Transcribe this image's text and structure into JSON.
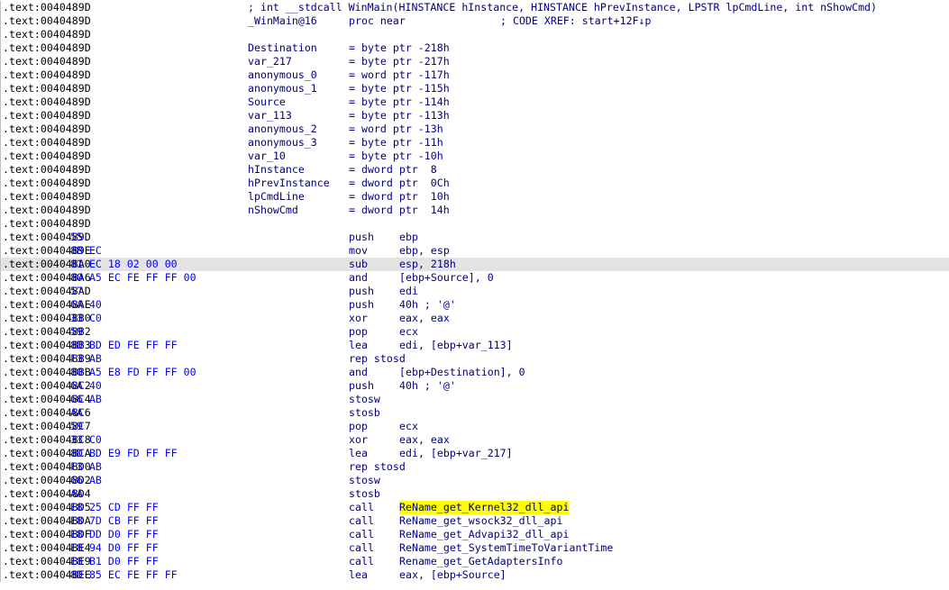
{
  "colors": {
    "address": "#000000",
    "bytes": "#0000ff",
    "code": "#000080",
    "current_line_bg": "#e3e3e3",
    "highlight_bg": "#ffff00"
  },
  "lines": [
    {
      "addr": ".text:0040489D",
      "bytes": "",
      "label": "",
      "mid": "",
      "mnemonic": "",
      "operand": "; int __stdcall WinMain(HINSTANCE hInstance, HINSTANCE hPrevInstance, LPSTR lpCmdLine, int nShowCmd)",
      "comment": ""
    },
    {
      "addr": ".text:0040489D",
      "bytes": "",
      "label": "_WinMain@16",
      "mid": "proc near",
      "mnemonic": "",
      "operand": "",
      "comment": "; CODE XREF: start+12F↓p"
    },
    {
      "addr": ".text:0040489D",
      "bytes": "",
      "label": "",
      "mid": "",
      "mnemonic": "",
      "operand": "",
      "comment": ""
    },
    {
      "addr": ".text:0040489D",
      "bytes": "",
      "label": "Destination",
      "mid": "= byte ptr -218h",
      "mnemonic": "",
      "operand": "",
      "comment": ""
    },
    {
      "addr": ".text:0040489D",
      "bytes": "",
      "label": "var_217",
      "mid": "= byte ptr -217h",
      "mnemonic": "",
      "operand": "",
      "comment": ""
    },
    {
      "addr": ".text:0040489D",
      "bytes": "",
      "label": "anonymous_0",
      "mid": "= word ptr -117h",
      "mnemonic": "",
      "operand": "",
      "comment": ""
    },
    {
      "addr": ".text:0040489D",
      "bytes": "",
      "label": "anonymous_1",
      "mid": "= byte ptr -115h",
      "mnemonic": "",
      "operand": "",
      "comment": ""
    },
    {
      "addr": ".text:0040489D",
      "bytes": "",
      "label": "Source",
      "mid": "= byte ptr -114h",
      "mnemonic": "",
      "operand": "",
      "comment": ""
    },
    {
      "addr": ".text:0040489D",
      "bytes": "",
      "label": "var_113",
      "mid": "= byte ptr -113h",
      "mnemonic": "",
      "operand": "",
      "comment": ""
    },
    {
      "addr": ".text:0040489D",
      "bytes": "",
      "label": "anonymous_2",
      "mid": "= word ptr -13h",
      "mnemonic": "",
      "operand": "",
      "comment": ""
    },
    {
      "addr": ".text:0040489D",
      "bytes": "",
      "label": "anonymous_3",
      "mid": "= byte ptr -11h",
      "mnemonic": "",
      "operand": "",
      "comment": ""
    },
    {
      "addr": ".text:0040489D",
      "bytes": "",
      "label": "var_10",
      "mid": "= byte ptr -10h",
      "mnemonic": "",
      "operand": "",
      "comment": ""
    },
    {
      "addr": ".text:0040489D",
      "bytes": "",
      "label": "hInstance",
      "mid": "= dword ptr  8",
      "mnemonic": "",
      "operand": "",
      "comment": ""
    },
    {
      "addr": ".text:0040489D",
      "bytes": "",
      "label": "hPrevInstance",
      "mid": "= dword ptr  0Ch",
      "mnemonic": "",
      "operand": "",
      "comment": ""
    },
    {
      "addr": ".text:0040489D",
      "bytes": "",
      "label": "lpCmdLine",
      "mid": "= dword ptr  10h",
      "mnemonic": "",
      "operand": "",
      "comment": ""
    },
    {
      "addr": ".text:0040489D",
      "bytes": "",
      "label": "nShowCmd",
      "mid": "= dword ptr  14h",
      "mnemonic": "",
      "operand": "",
      "comment": ""
    },
    {
      "addr": ".text:0040489D",
      "bytes": "",
      "label": "",
      "mid": "",
      "mnemonic": "",
      "operand": "",
      "comment": ""
    },
    {
      "addr": ".text:0040489D",
      "bytes": "55",
      "label": "",
      "mid": "",
      "mnemonic": "push",
      "operand": "ebp",
      "comment": ""
    },
    {
      "addr": ".text:0040489E",
      "bytes": "8B EC",
      "label": "",
      "mid": "",
      "mnemonic": "mov",
      "operand": "ebp, esp",
      "comment": ""
    },
    {
      "addr": ".text:004048A0",
      "bytes": "81 EC 18 02 00 00",
      "label": "",
      "mid": "",
      "mnemonic": "sub",
      "operand": "esp, 218h",
      "comment": "",
      "current": true
    },
    {
      "addr": ".text:004048A6",
      "bytes": "80 A5 EC FE FF FF 00",
      "label": "",
      "mid": "",
      "mnemonic": "and",
      "operand": "[ebp+Source], 0",
      "comment": ""
    },
    {
      "addr": ".text:004048AD",
      "bytes": "57",
      "label": "",
      "mid": "",
      "mnemonic": "push",
      "operand": "edi",
      "comment": ""
    },
    {
      "addr": ".text:004048AE",
      "bytes": "6A 40",
      "label": "",
      "mid": "",
      "mnemonic": "push",
      "operand": "40h ; '@'",
      "comment": ""
    },
    {
      "addr": ".text:004048B0",
      "bytes": "33 C0",
      "label": "",
      "mid": "",
      "mnemonic": "xor",
      "operand": "eax, eax",
      "comment": ""
    },
    {
      "addr": ".text:004048B2",
      "bytes": "59",
      "label": "",
      "mid": "",
      "mnemonic": "pop",
      "operand": "ecx",
      "comment": ""
    },
    {
      "addr": ".text:004048B3",
      "bytes": "8D BD ED FE FF FF",
      "label": "",
      "mid": "",
      "mnemonic": "lea",
      "operand": "edi, [ebp+var_113]",
      "comment": ""
    },
    {
      "addr": ".text:004048B9",
      "bytes": "F3 AB",
      "label": "",
      "mid": "",
      "mnemonic": "rep stosd",
      "operand": "",
      "comment": ""
    },
    {
      "addr": ".text:004048BB",
      "bytes": "80 A5 E8 FD FF FF 00",
      "label": "",
      "mid": "",
      "mnemonic": "and",
      "operand": "[ebp+Destination], 0",
      "comment": ""
    },
    {
      "addr": ".text:004048C2",
      "bytes": "6A 40",
      "label": "",
      "mid": "",
      "mnemonic": "push",
      "operand": "40h ; '@'",
      "comment": ""
    },
    {
      "addr": ".text:004048C4",
      "bytes": "66 AB",
      "label": "",
      "mid": "",
      "mnemonic": "stosw",
      "operand": "",
      "comment": ""
    },
    {
      "addr": ".text:004048C6",
      "bytes": "AA",
      "label": "",
      "mid": "",
      "mnemonic": "stosb",
      "operand": "",
      "comment": ""
    },
    {
      "addr": ".text:004048C7",
      "bytes": "59",
      "label": "",
      "mid": "",
      "mnemonic": "pop",
      "operand": "ecx",
      "comment": ""
    },
    {
      "addr": ".text:004048C8",
      "bytes": "33 C0",
      "label": "",
      "mid": "",
      "mnemonic": "xor",
      "operand": "eax, eax",
      "comment": ""
    },
    {
      "addr": ".text:004048CA",
      "bytes": "8D BD E9 FD FF FF",
      "label": "",
      "mid": "",
      "mnemonic": "lea",
      "operand": "edi, [ebp+var_217]",
      "comment": ""
    },
    {
      "addr": ".text:004048D0",
      "bytes": "F3 AB",
      "label": "",
      "mid": "",
      "mnemonic": "rep stosd",
      "operand": "",
      "comment": ""
    },
    {
      "addr": ".text:004048D2",
      "bytes": "66 AB",
      "label": "",
      "mid": "",
      "mnemonic": "stosw",
      "operand": "",
      "comment": ""
    },
    {
      "addr": ".text:004048D4",
      "bytes": "AA",
      "label": "",
      "mid": "",
      "mnemonic": "stosb",
      "operand": "",
      "comment": ""
    },
    {
      "addr": ".text:004048D5",
      "bytes": "E8 25 CD FF FF",
      "label": "",
      "mid": "",
      "mnemonic": "call",
      "operand": "ReName_get_Kernel32_dll_api",
      "comment": "",
      "highlight": true
    },
    {
      "addr": ".text:004048DA",
      "bytes": "E8 7D CB FF FF",
      "label": "",
      "mid": "",
      "mnemonic": "call",
      "operand": "ReName_get_wsock32_dll_api",
      "comment": ""
    },
    {
      "addr": ".text:004048DF",
      "bytes": "E8 DD D0 FF FF",
      "label": "",
      "mid": "",
      "mnemonic": "call",
      "operand": "ReName_get_Advapi32_dll_api",
      "comment": ""
    },
    {
      "addr": ".text:004048E4",
      "bytes": "E8 94 D0 FF FF",
      "label": "",
      "mid": "",
      "mnemonic": "call",
      "operand": "ReName_get_SystemTimeToVariantTime",
      "comment": ""
    },
    {
      "addr": ".text:004048E9",
      "bytes": "E8 B1 D0 FF FF",
      "label": "",
      "mid": "",
      "mnemonic": "call",
      "operand": "Rename_get_GetAdaptersInfo",
      "comment": ""
    },
    {
      "addr": ".text:004048EE",
      "bytes": "8D 85 EC FE FF FF",
      "label": "",
      "mid": "",
      "mnemonic": "lea",
      "operand": "eax, [ebp+Source]",
      "comment": ""
    }
  ]
}
